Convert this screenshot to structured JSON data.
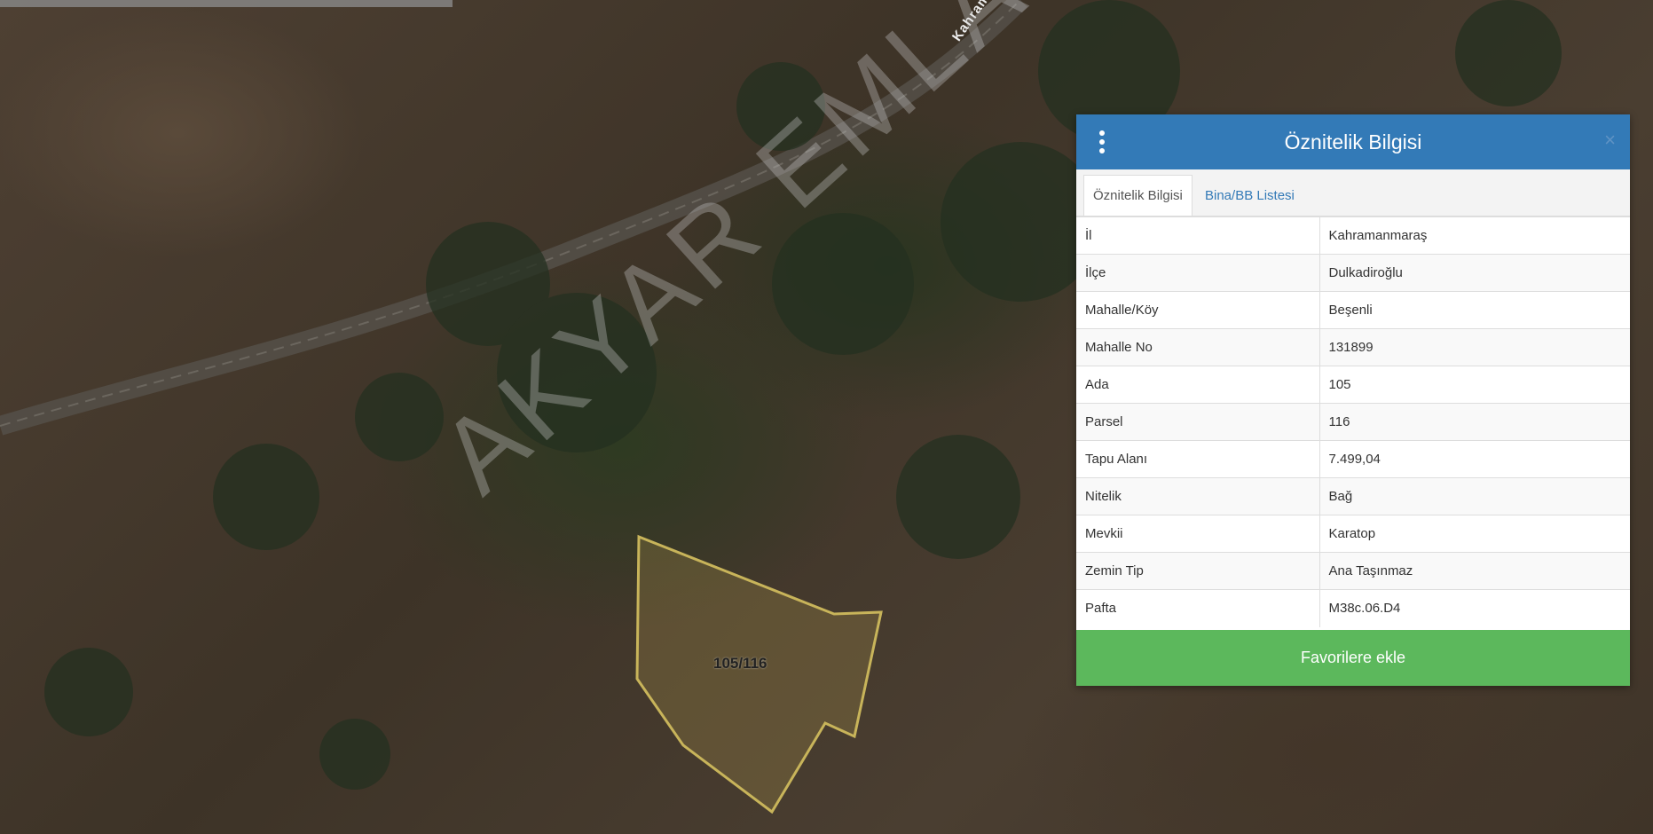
{
  "map": {
    "parcel_label": "105/116",
    "road_label": "Kahramanm",
    "watermark": "AKYAR EMLAK"
  },
  "panel": {
    "title": "Öznitelik Bilgisi",
    "close_symbol": "×",
    "tabs": [
      {
        "label": "Öznitelik Bilgisi",
        "active": true
      },
      {
        "label": "Bina/BB Listesi",
        "active": false
      }
    ],
    "rows": [
      {
        "key": "İl",
        "value": "Kahramanmaraş"
      },
      {
        "key": "İlçe",
        "value": "Dulkadiroğlu"
      },
      {
        "key": "Mahalle/Köy",
        "value": "Beşenli"
      },
      {
        "key": "Mahalle No",
        "value": "131899"
      },
      {
        "key": "Ada",
        "value": "105"
      },
      {
        "key": "Parsel",
        "value": "116"
      },
      {
        "key": "Tapu Alanı",
        "value": "7.499,04"
      },
      {
        "key": "Nitelik",
        "value": "Bağ"
      },
      {
        "key": "Mevkii",
        "value": "Karatop"
      },
      {
        "key": "Zemin Tip",
        "value": "Ana Taşınmaz"
      },
      {
        "key": "Pafta",
        "value": "M38c.06.D4"
      }
    ],
    "favorite_button": "Favorilere ekle"
  },
  "colors": {
    "header": "#337ab7",
    "button": "#5cb85c",
    "parcel_outline": "#c8b45a"
  }
}
